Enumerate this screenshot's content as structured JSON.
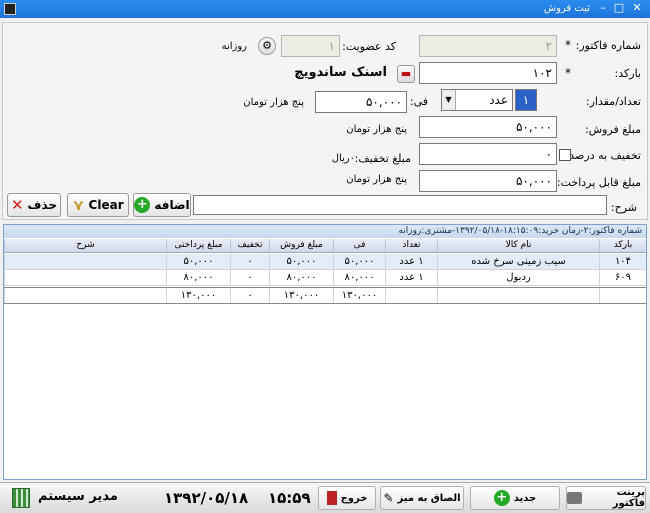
{
  "window": {
    "title": "ثبت فروش"
  },
  "form": {
    "invoice_no_label": "شماره فاکتور:",
    "invoice_no_value": "۲",
    "member_code_label": "کد عضویت:",
    "member_code_value": "۱",
    "customer_type": "روزانه",
    "barcode_label": "بارکد:",
    "barcode_value": "۱۰۲",
    "product_name": "اسنک ساندویچ",
    "qty_label": "تعداد/مقدار:",
    "qty_value": "۱",
    "unit_value": "عدد",
    "price_label": "فی:",
    "price_value": "۵۰,۰۰۰",
    "price_words": "پنج هزار تومان",
    "sale_amount_label": "مبلغ فروش:",
    "sale_amount_value": "۵۰,۰۰۰",
    "sale_amount_words": "پنج هزار تومان",
    "discount_percent_label": "تخفیف به درصد؟",
    "discount_value": "۰",
    "discount_amount_label": "مبلغ تخفیف:",
    "discount_amount_value": "۰ریال",
    "payable_label": "مبلغ قابل پرداخت:",
    "payable_value": "۵۰,۰۰۰",
    "payable_words": "پنج هزار تومان",
    "description_label": "شرح:",
    "description_value": "",
    "delete_label": "حذف",
    "clear_label": "Clear",
    "add_label": "اضافه"
  },
  "grid": {
    "caption": "شماره فاکتور:۲-زمان خرید:۱۸:۱۵:۰۹-۱۳۹۲/۰۵/۱۸-مشتری:روزانه",
    "columns": [
      "بارکد",
      "نام کالا",
      "تعداد",
      "فی",
      "مبلغ فروش",
      "تخفیف",
      "مبلغ پرداختی",
      "شرح"
    ],
    "rows": [
      {
        "barcode": "۱۰۴",
        "name": "سیب زمینی سرخ شده",
        "qty": "۱ عدد",
        "price": "۵۰,۰۰۰",
        "sale": "۵۰,۰۰۰",
        "discount": "۰",
        "paid": "۵۰,۰۰۰",
        "desc": ""
      },
      {
        "barcode": "۶۰۹",
        "name": "ردبول",
        "qty": "۱ عدد",
        "price": "۸۰,۰۰۰",
        "sale": "۸۰,۰۰۰",
        "discount": "۰",
        "paid": "۸۰,۰۰۰",
        "desc": ""
      }
    ],
    "totals": {
      "barcode": "",
      "name": "",
      "qty": "",
      "price": "۱۳۰,۰۰۰",
      "sale": "۱۳۰,۰۰۰",
      "discount": "۰",
      "paid": "۱۳۰,۰۰۰",
      "desc": ""
    }
  },
  "status": {
    "print_label": "پرینت فاکتور",
    "new_label": "جدید",
    "attach_label": "الصاق به میز",
    "exit_label": "خروج",
    "time": "۱۵:۵۹",
    "date": "۱۳۹۲/۰۵/۱۸",
    "user": "مدیر سیستم"
  }
}
